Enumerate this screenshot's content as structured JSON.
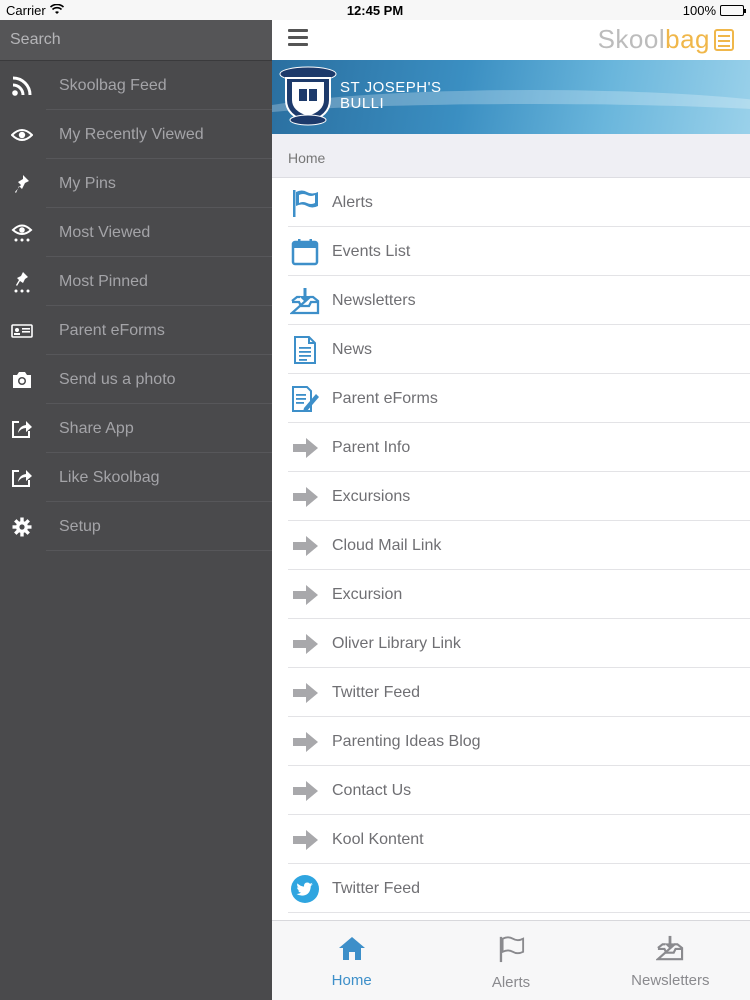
{
  "statusbar": {
    "carrier": "Carrier",
    "time": "12:45 PM",
    "battery": "100%"
  },
  "sidebar": {
    "search_label": "Search",
    "items": [
      {
        "label": "Skoolbag Feed",
        "icon": "rss-icon"
      },
      {
        "label": "My Recently Viewed",
        "icon": "eye-icon"
      },
      {
        "label": "My Pins",
        "icon": "pin-icon"
      },
      {
        "label": "Most Viewed",
        "icon": "eye-dots-icon"
      },
      {
        "label": "Most Pinned",
        "icon": "pin-dots-icon"
      },
      {
        "label": "Parent eForms",
        "icon": "id-card-icon"
      },
      {
        "label": "Send us a photo",
        "icon": "camera-icon"
      },
      {
        "label": "Share App",
        "icon": "share-icon"
      },
      {
        "label": "Like Skoolbag",
        "icon": "share-icon"
      },
      {
        "label": "Setup",
        "icon": "gear-icon"
      }
    ]
  },
  "header": {
    "brand_prefix": "Skool",
    "brand_suffix": "bag"
  },
  "banner": {
    "school_line1": "ST JOSEPH'S",
    "school_line2": "BULLI"
  },
  "breadcrumb": "Home",
  "menu": {
    "items": [
      {
        "label": "Alerts",
        "icon": "flag-icon"
      },
      {
        "label": "Events List",
        "icon": "calendar-icon"
      },
      {
        "label": "Newsletters",
        "icon": "inbox-download-icon"
      },
      {
        "label": "News",
        "icon": "document-icon"
      },
      {
        "label": "Parent eForms",
        "icon": "form-edit-icon"
      },
      {
        "label": "Parent Info",
        "icon": "arrow-right-icon"
      },
      {
        "label": "Excursions",
        "icon": "arrow-right-icon"
      },
      {
        "label": "Cloud Mail Link",
        "icon": "arrow-right-icon"
      },
      {
        "label": "Excursion",
        "icon": "arrow-right-icon"
      },
      {
        "label": "Oliver Library Link",
        "icon": "arrow-right-icon"
      },
      {
        "label": "Twitter Feed",
        "icon": "arrow-right-icon"
      },
      {
        "label": "Parenting Ideas Blog",
        "icon": "arrow-right-icon"
      },
      {
        "label": "Contact Us",
        "icon": "arrow-right-icon"
      },
      {
        "label": "Kool Kontent",
        "icon": "arrow-right-icon"
      },
      {
        "label": "Twitter Feed",
        "icon": "twitter-icon"
      }
    ]
  },
  "tabbar": {
    "tabs": [
      {
        "label": "Home",
        "icon": "home-icon",
        "active": true
      },
      {
        "label": "Alerts",
        "icon": "flag-icon",
        "active": false
      },
      {
        "label": "Newsletters",
        "icon": "inbox-download-icon",
        "active": false
      }
    ]
  },
  "colors": {
    "accent": "#3d8fc9",
    "sidebar_bg": "#4a4a4c",
    "arrow_gray": "#a8a8ab"
  }
}
